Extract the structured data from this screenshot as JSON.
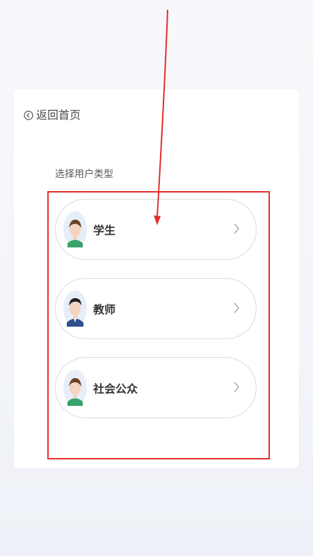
{
  "header": {
    "back_label": "返回首页"
  },
  "section": {
    "title": "选择用户类型"
  },
  "options": [
    {
      "label": "学生",
      "icon": "student-avatar-icon"
    },
    {
      "label": "教师",
      "icon": "teacher-avatar-icon"
    },
    {
      "label": "社会公众",
      "icon": "public-avatar-icon"
    }
  ],
  "colors": {
    "annotation": "#e52b2b",
    "card_bg": "#ffffff",
    "text_primary": "#333333",
    "text_secondary": "#5a5a5a",
    "option_border": "#d9d9d9"
  }
}
